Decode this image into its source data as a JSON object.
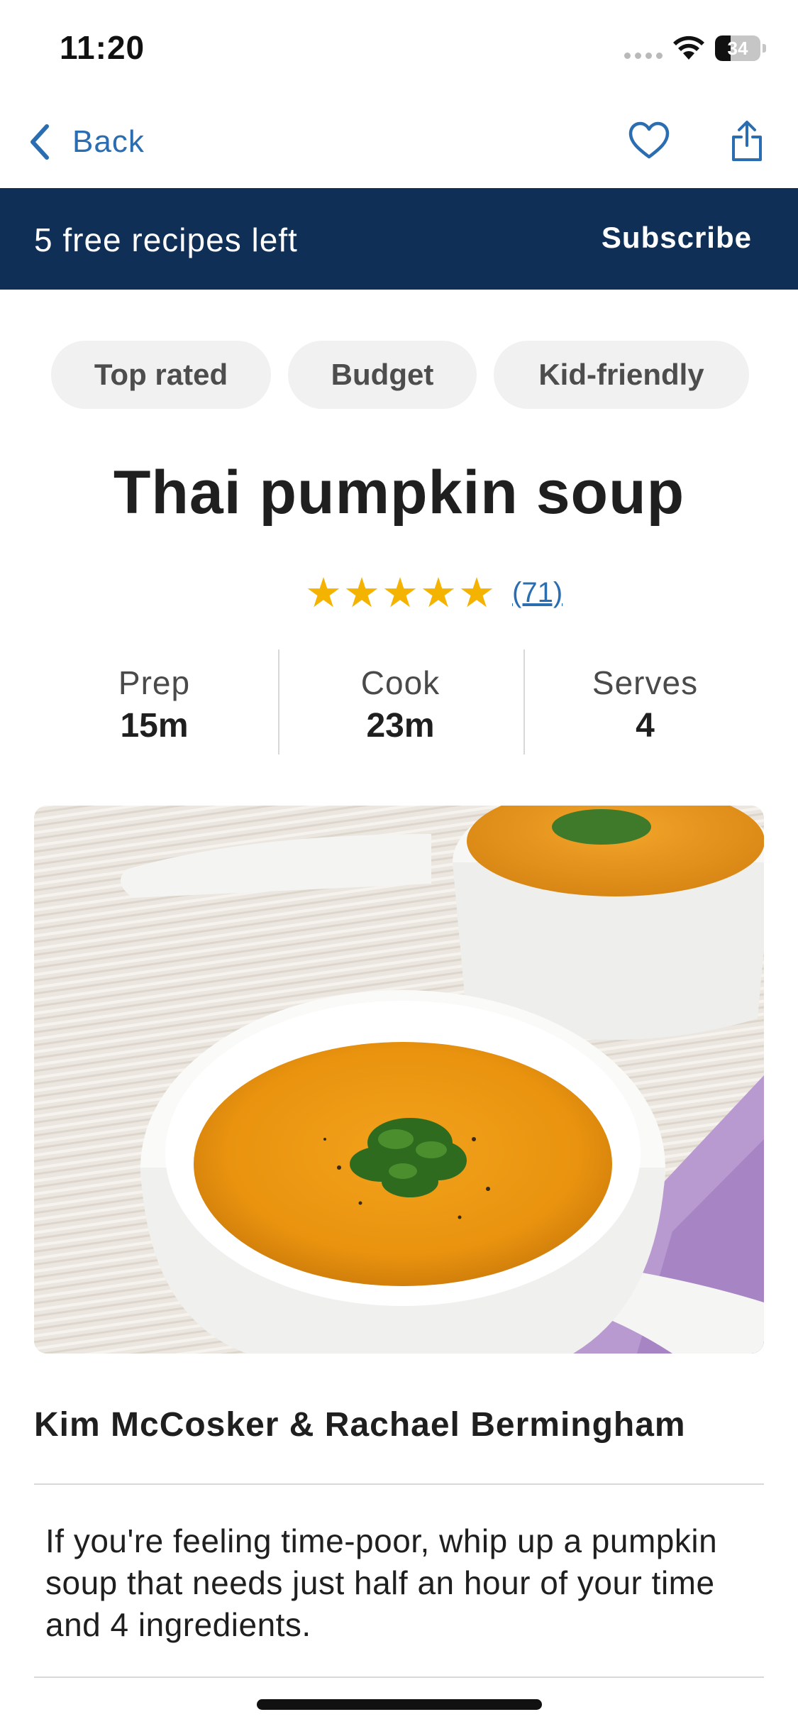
{
  "status_bar": {
    "time": "11:20",
    "battery_level": "34",
    "battery_fraction": 0.34
  },
  "nav": {
    "back_label": "Back",
    "icons": [
      "chevron-left-icon",
      "heart-icon",
      "share-icon"
    ],
    "accent_color": "#2a6db0"
  },
  "banner": {
    "text": "5 free recipes left",
    "subscribe_label": "Subscribe",
    "background_color": "#0f2f57"
  },
  "tags": [
    {
      "label": "Top rated"
    },
    {
      "label": "Budget"
    },
    {
      "label": "Kid-friendly"
    }
  ],
  "recipe": {
    "title": "Thai pumpkin soup",
    "rating_stars": 5,
    "rating_count": "(71)",
    "star_color": "#f5b301",
    "stats": [
      {
        "label": "Prep",
        "value": "15m"
      },
      {
        "label": "Cook",
        "value": "23m"
      },
      {
        "label": "Serves",
        "value": "4"
      }
    ],
    "photo": "pumpkin-soup-photo",
    "author": "Kim McCosker & Rachael Bermingham",
    "description": "If you're feeling time-poor, whip up a pumpkin soup that needs just half an hour of your time and 4 ingredients."
  }
}
